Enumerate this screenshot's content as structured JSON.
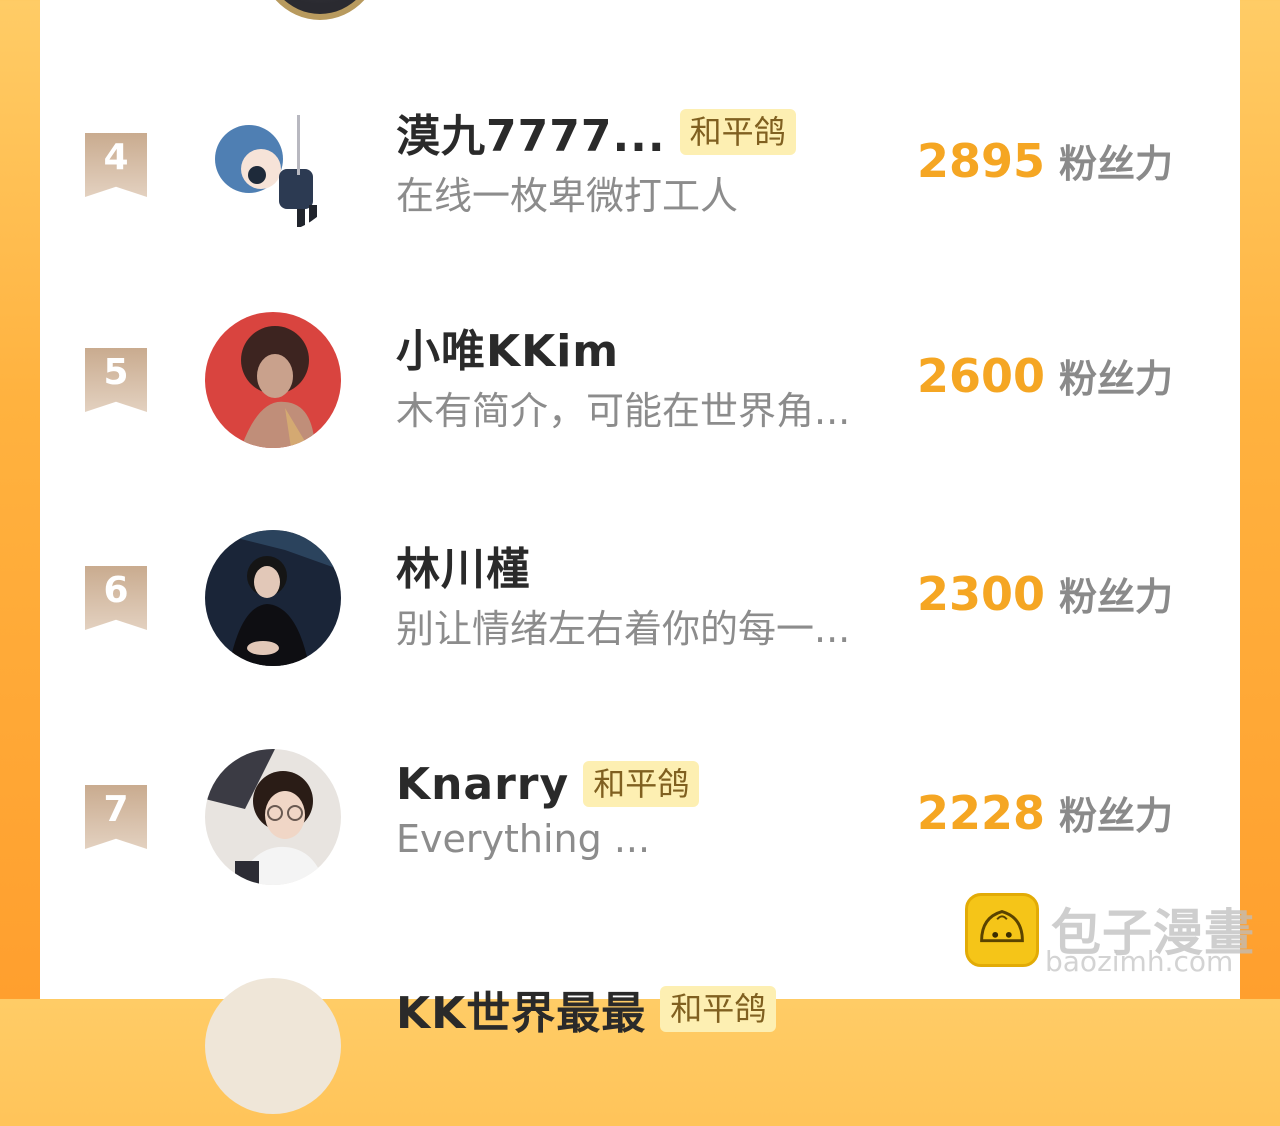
{
  "score_unit": "粉丝力",
  "rows": [
    {
      "rank": "4",
      "name": "漠九7777...",
      "badge": "和平鸽",
      "bio": "在线一枚卑微打工人",
      "score": "2895"
    },
    {
      "rank": "5",
      "name": "小唯KKim",
      "badge": "",
      "bio": "木有简介，可能在世界角...",
      "score": "2600"
    },
    {
      "rank": "6",
      "name": "林川槿",
      "badge": "",
      "bio": "别让情绪左右着你的每一...",
      "score": "2300"
    },
    {
      "rank": "7",
      "name": "Knarry",
      "badge": "和平鸽",
      "bio": "Everything ...",
      "score": "2228"
    },
    {
      "rank": "",
      "name": "KK世界最最",
      "badge": "和平鸽",
      "bio": "",
      "score": ""
    }
  ],
  "watermark": {
    "title": "包子漫畫",
    "sub": "baozimh.com"
  },
  "colors": {
    "accent": "#f5a623",
    "badge_bg": "#fdefb2",
    "frame": "#ffb23f"
  }
}
